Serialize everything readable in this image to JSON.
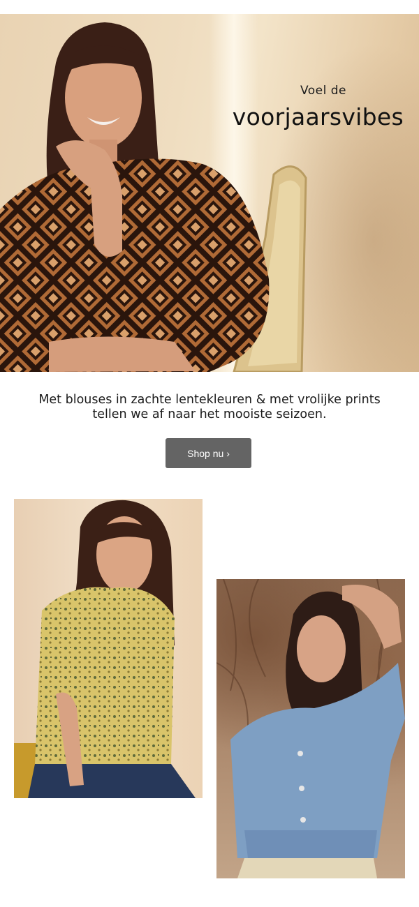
{
  "hero": {
    "subtitle": "Voel de",
    "title": "voorjaarsvibes"
  },
  "intro": {
    "line1": "Met blouses in zachte lentekleuren & met vrolijke prints",
    "line2": "tellen we af naar het mooiste seizoen."
  },
  "cta": {
    "label": "Shop nu ›"
  },
  "colors": {
    "button_bg": "#646464",
    "background": "#ffffff"
  }
}
